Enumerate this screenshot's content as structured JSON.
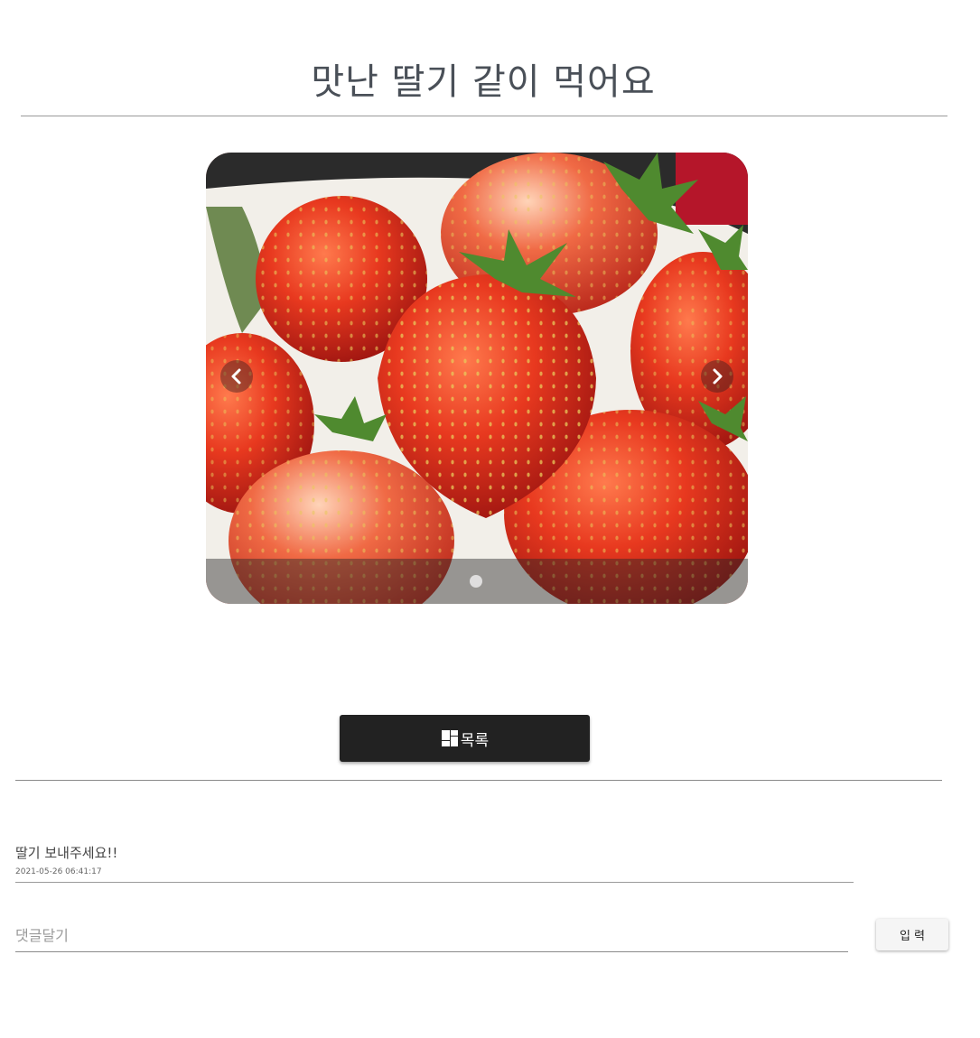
{
  "post": {
    "title": "맛난 딸기 같이 먹어요"
  },
  "carousel": {
    "image_subject": "strawberries",
    "slide_count": 1,
    "active_index": 0,
    "prev_icon": "chevron-left-icon",
    "next_icon": "chevron-right-icon"
  },
  "actions": {
    "list_label": "목록",
    "list_icon": "dashboard-icon"
  },
  "comments": [
    {
      "text": "딸기 보내주세요!!",
      "date": "2021-05-26 06:41:17"
    }
  ],
  "comment_form": {
    "placeholder": "댓글달기",
    "value": "",
    "submit_label": "입 력"
  },
  "colors": {
    "button_dark": "#222222",
    "rule": "#9a9a9a"
  }
}
